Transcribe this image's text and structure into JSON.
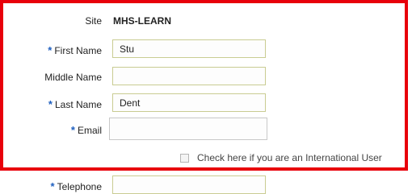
{
  "form": {
    "site_label": "Site",
    "site_value": "MHS-LEARN",
    "required_marker": "*",
    "first_name": {
      "label": "First Name",
      "value": "Stu",
      "required": true
    },
    "middle_name": {
      "label": "Middle Name",
      "value": "",
      "required": false
    },
    "last_name": {
      "label": "Last Name",
      "value": "Dent",
      "required": true
    },
    "email": {
      "label": "Email",
      "value": "",
      "required": true
    },
    "international_checkbox": {
      "label": "Check here if you are an International User",
      "checked": false
    },
    "telephone": {
      "label": "Telephone",
      "value": "",
      "required": true
    }
  },
  "colors": {
    "highlight_border": "#e8000b",
    "required_marker": "#1f5fbf",
    "field_border": "#c9cc92"
  }
}
